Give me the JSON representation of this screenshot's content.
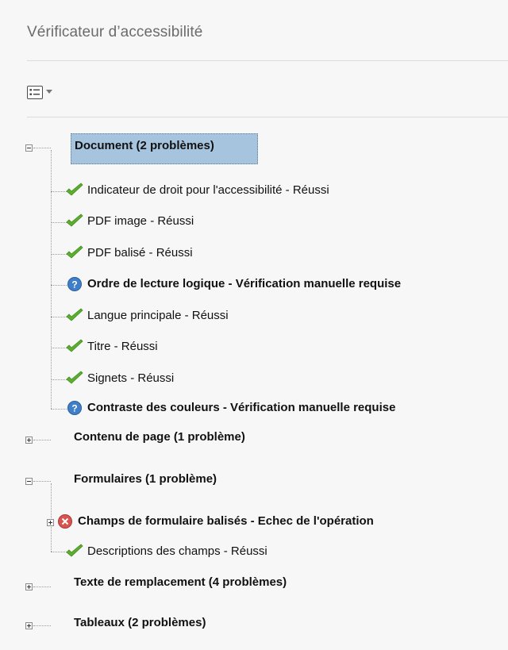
{
  "panel": {
    "title": "Vérificateur d’accessibilité",
    "options_icon": "list-options-icon"
  },
  "tree": {
    "document": {
      "label": "Document (2 problèmes)",
      "expanded": true,
      "items": [
        {
          "label": "Indicateur de droit pour l'accessibilité - Réussi",
          "status": "passed",
          "icon": "check-icon"
        },
        {
          "label": "PDF image - Réussi",
          "status": "passed",
          "icon": "check-icon"
        },
        {
          "label": "PDF balisé - Réussi",
          "status": "passed",
          "icon": "check-icon"
        },
        {
          "label": "Ordre de lecture logique - Vérification manuelle requise",
          "status": "manual",
          "icon": "question-icon"
        },
        {
          "label": "Langue principale - Réussi",
          "status": "passed",
          "icon": "check-icon"
        },
        {
          "label": "Titre - Réussi",
          "status": "passed",
          "icon": "check-icon"
        },
        {
          "label": "Signets - Réussi",
          "status": "passed",
          "icon": "check-icon"
        },
        {
          "label": "Contraste des couleurs - Vérification manuelle requise",
          "status": "manual",
          "icon": "question-icon"
        }
      ]
    },
    "page_content": {
      "label": "Contenu de page (1 problème)",
      "expanded": false
    },
    "forms": {
      "label": "Formulaires (1 problème)",
      "expanded": true,
      "items": [
        {
          "label": "Champs de formulaire balisés - Echec de l'opération",
          "status": "failed",
          "icon": "error-icon"
        },
        {
          "label": "Descriptions des champs - Réussi",
          "status": "passed",
          "icon": "check-icon"
        }
      ]
    },
    "alt_text": {
      "label": "Texte de remplacement (4 problèmes)",
      "expanded": false
    },
    "tables": {
      "label": "Tableaux (2 problèmes)",
      "expanded": false
    }
  },
  "colors": {
    "selection": "#a7c4df",
    "check": "#5cae2f",
    "question": "#3f7fc9",
    "error": "#d9534f"
  }
}
